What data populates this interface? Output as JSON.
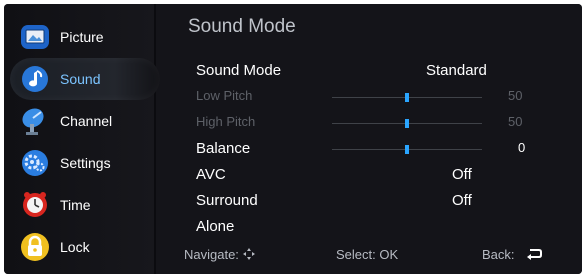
{
  "sidebar": {
    "items": [
      {
        "label": "Picture",
        "icon": "picture-icon"
      },
      {
        "label": "Sound",
        "icon": "music-note-icon",
        "active": true
      },
      {
        "label": "Channel",
        "icon": "satellite-icon"
      },
      {
        "label": "Settings",
        "icon": "gear-icon"
      },
      {
        "label": "Time",
        "icon": "clock-icon"
      },
      {
        "label": "Lock",
        "icon": "lock-icon"
      }
    ]
  },
  "panel": {
    "title": "Sound Mode",
    "rows": [
      {
        "label": "Sound Mode",
        "value": "Standard"
      },
      {
        "label": "Low Pitch",
        "value": "50",
        "level": 0.5
      },
      {
        "label": "High Pitch",
        "value": "50",
        "level": 0.5
      },
      {
        "label": "Balance",
        "value": "0",
        "level": 0.5
      },
      {
        "label": "AVC",
        "value": "Off"
      },
      {
        "label": "Surround",
        "value": "Off"
      },
      {
        "label": "Alone",
        "value": ""
      }
    ]
  },
  "footer": {
    "navigate": "Navigate:",
    "select": "Select: OK",
    "back": "Back:"
  },
  "colors": {
    "accent": "#2aa5ff",
    "active_text": "#7cc4ff"
  }
}
